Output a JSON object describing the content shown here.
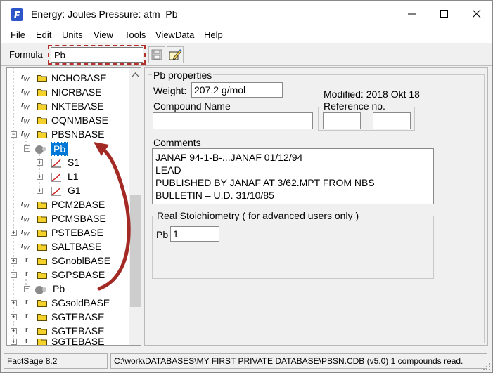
{
  "window": {
    "title": "Energy: Joules Pressure: atm  Pb"
  },
  "menu": [
    "File",
    "Edit",
    "Units",
    "View",
    "Tools",
    "ViewData",
    "Help"
  ],
  "toolbar": {
    "formula_label": "Formula",
    "formula_value": "Pb"
  },
  "tree": {
    "rw_prefix": "r",
    "rw_sub": "W",
    "items": [
      "NCHOBASE",
      "NICRBASE",
      "NKTEBASE",
      "OQNMBASE",
      "PBSNBASE",
      "Pb",
      "S1",
      "L1",
      "G1",
      "PCM2BASE",
      "PCMSBASE",
      "PSTEBASE",
      "SALTBASE",
      "SGnoblBASE",
      "SGPSBASE",
      "Pb",
      "SGsoldBASE",
      "SGTEBASE",
      "SGTEBASE",
      "SGTEBASE"
    ]
  },
  "props": {
    "group_title": "Pb properties",
    "weight_label": "Weight:",
    "weight_value": "207.2 g/mol",
    "modified": "Modified: 2018 Okt 18",
    "compound_label": "Compound Name",
    "compound_value": "",
    "reference_label": "Reference no.",
    "reference_1": "",
    "reference_2": "",
    "comments_label": "Comments",
    "comments": [
      "JANAF 94-1-B-...JANAF 01/12/94",
      "LEAD",
      "PUBLISHED BY JANAF AT 3/62.MPT FROM NBS",
      "BULLETIN – U.D. 31/10/85"
    ],
    "stoich_title": "Real Stoichiometry ( for advanced users only )",
    "stoich_element": "Pb",
    "stoich_value": "1"
  },
  "status": {
    "version": "FactSage 8.2",
    "path": "C:\\work\\DATABASES\\MY FIRST PRIVATE DATABASE\\PBSN.CDB (v5.0) 1 compounds read."
  },
  "colors": {
    "selection": "#0078d7",
    "annotation": "#b3302a",
    "folder": "#f5d22b"
  },
  "icons": [
    "factsage-logo-icon",
    "minimize-icon",
    "maximize-icon",
    "close-icon",
    "save-icon",
    "edit-icon",
    "folder-icon",
    "element-icon",
    "phase-curve-icon"
  ]
}
